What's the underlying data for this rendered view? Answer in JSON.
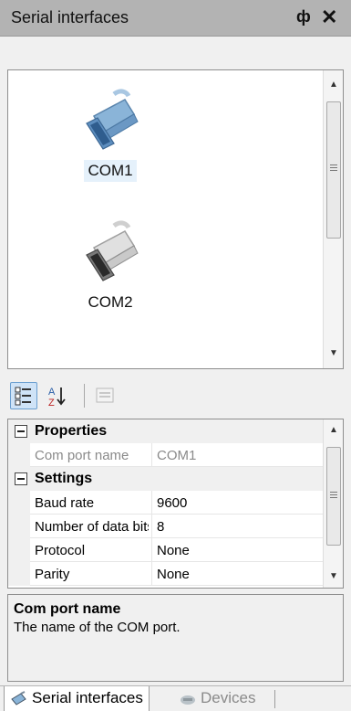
{
  "panel": {
    "title": "Serial interfaces",
    "pin_glyph": "ф",
    "close_glyph": "✕"
  },
  "ports": [
    {
      "name": "COM1",
      "icon": "serial-cable-active-icon",
      "selected": true,
      "color": "#8ab4d8"
    },
    {
      "name": "COM2",
      "icon": "serial-cable-inactive-icon",
      "selected": false,
      "color": "#d6d6d6"
    }
  ],
  "toolbar": {
    "categorized": "categorized-view-icon",
    "alphabetical": "sort-alphabetical-icon",
    "property_pages": "property-pages-icon"
  },
  "property_grid": {
    "rows": [
      {
        "type": "category",
        "label": "Properties"
      },
      {
        "type": "property",
        "name": "Com port name",
        "value": "COM1",
        "readonly": true
      },
      {
        "type": "category",
        "label": "Settings"
      },
      {
        "type": "property",
        "name": "Baud rate",
        "value": "9600"
      },
      {
        "type": "property",
        "name": "Number of data bits",
        "value": "8"
      },
      {
        "type": "property",
        "name": "Protocol",
        "value": "None"
      },
      {
        "type": "property",
        "name": "Parity",
        "value": "None"
      }
    ]
  },
  "description": {
    "title": "Com port name",
    "text": "The name of the COM port."
  },
  "tabs": [
    {
      "label": "Serial interfaces",
      "active": true,
      "icon": "serial-interfaces-tab-icon"
    },
    {
      "label": "Devices",
      "active": false,
      "icon": "devices-tab-icon"
    }
  ],
  "colors": {
    "accent": "#6a9ecf",
    "selection": "#e5f1fb",
    "title_bar": "#b3b3b3"
  }
}
